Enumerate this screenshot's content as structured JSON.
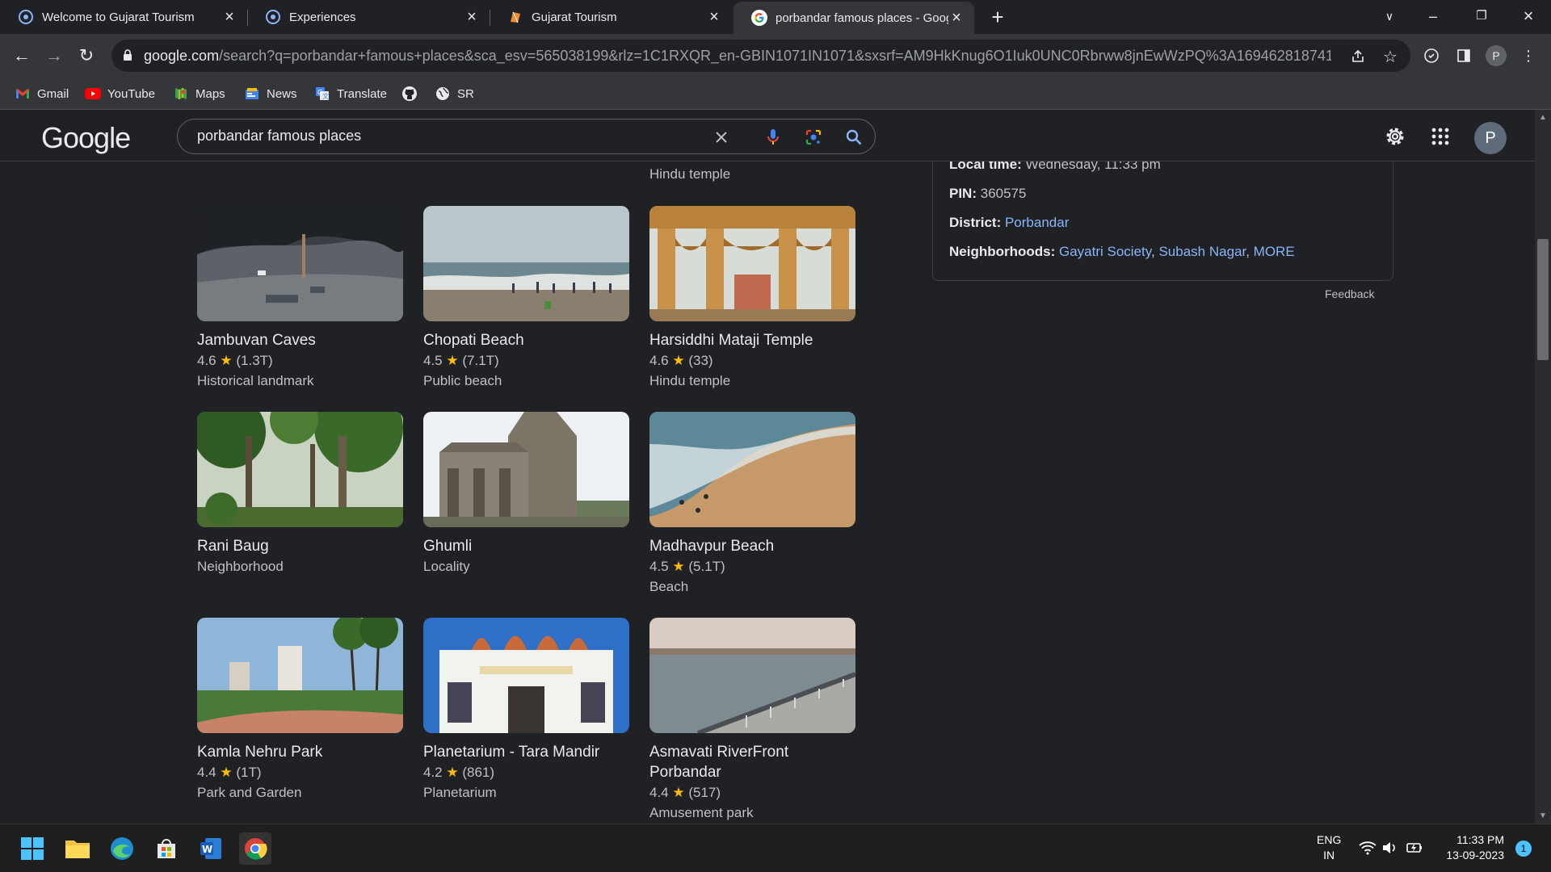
{
  "browser": {
    "tabs": [
      {
        "title": "Welcome to Gujarat Tourism",
        "active": false
      },
      {
        "title": "Experiences",
        "active": false
      },
      {
        "title": "Gujarat Tourism",
        "active": false
      },
      {
        "title": "porbandar famous places - Goog",
        "active": true
      }
    ],
    "url_host": "google.com",
    "url_rest": "/search?q=porbandar+famous+places&sca_esv=565038199&rlz=1C1RXQR_en-GBIN1071IN1071&sxsrf=AM9HkKnug6O1Iuk0UNC0Rbrww8jnEwWzPQ%3A1694628187414&ei=W...",
    "profile_initial": "P",
    "bookmarks": [
      {
        "label": "Gmail",
        "icon": "gmail-icon"
      },
      {
        "label": "YouTube",
        "icon": "youtube-icon"
      },
      {
        "label": "Maps",
        "icon": "maps-icon"
      },
      {
        "label": "News",
        "icon": "news-icon"
      },
      {
        "label": "Translate",
        "icon": "translate-icon"
      },
      {
        "label": "",
        "icon": "github-icon"
      },
      {
        "label": "SR",
        "icon": "globe-icon"
      }
    ]
  },
  "google": {
    "logo": "Google",
    "query": "porbandar famous places",
    "avatar_initial": "P"
  },
  "results": {
    "top_partial_type": "Hindu temple",
    "places": [
      {
        "name": "Jambuvan Caves",
        "rating": "4.6",
        "reviews": "(1.3T)",
        "type": "Historical landmark"
      },
      {
        "name": "Chopati Beach",
        "rating": "4.5",
        "reviews": "(7.1T)",
        "type": "Public beach"
      },
      {
        "name": "Harsiddhi Mataji Temple",
        "rating": "4.6",
        "reviews": "(33)",
        "type": "Hindu temple"
      },
      {
        "name": "Rani Baug",
        "rating": "",
        "reviews": "",
        "type": "Neighborhood"
      },
      {
        "name": "Ghumli",
        "rating": "",
        "reviews": "",
        "type": "Locality"
      },
      {
        "name": "Madhavpur Beach",
        "rating": "4.5",
        "reviews": "(5.1T)",
        "type": "Beach"
      },
      {
        "name": "Kamla Nehru Park",
        "rating": "4.4",
        "reviews": "(1T)",
        "type": "Park and Garden"
      },
      {
        "name": "Planetarium - Tara Mandir",
        "rating": "4.2",
        "reviews": "(861)",
        "type": "Planetarium"
      },
      {
        "name": "Asmavati RiverFront Porbandar",
        "rating": "4.4",
        "reviews": "(517)",
        "type": "Amusement park"
      }
    ]
  },
  "knowledge_panel": {
    "local_time_label": "Local time:",
    "local_time_value": "Wednesday, 11:33 pm",
    "pin_label": "PIN:",
    "pin_value": "360575",
    "district_label": "District:",
    "district_value": "Porbandar",
    "neighborhoods_label": "Neighborhoods:",
    "neighborhoods": [
      "Gayatri Society",
      "Subash Nagar",
      "MORE"
    ],
    "feedback": "Feedback"
  },
  "taskbar": {
    "lang_line1": "ENG",
    "lang_line2": "IN",
    "time": "11:33 PM",
    "date": "13-09-2023",
    "notification_count": "1"
  },
  "colors": {
    "link": "#8ab4f8",
    "star": "#fbbc04",
    "background": "#202124"
  }
}
